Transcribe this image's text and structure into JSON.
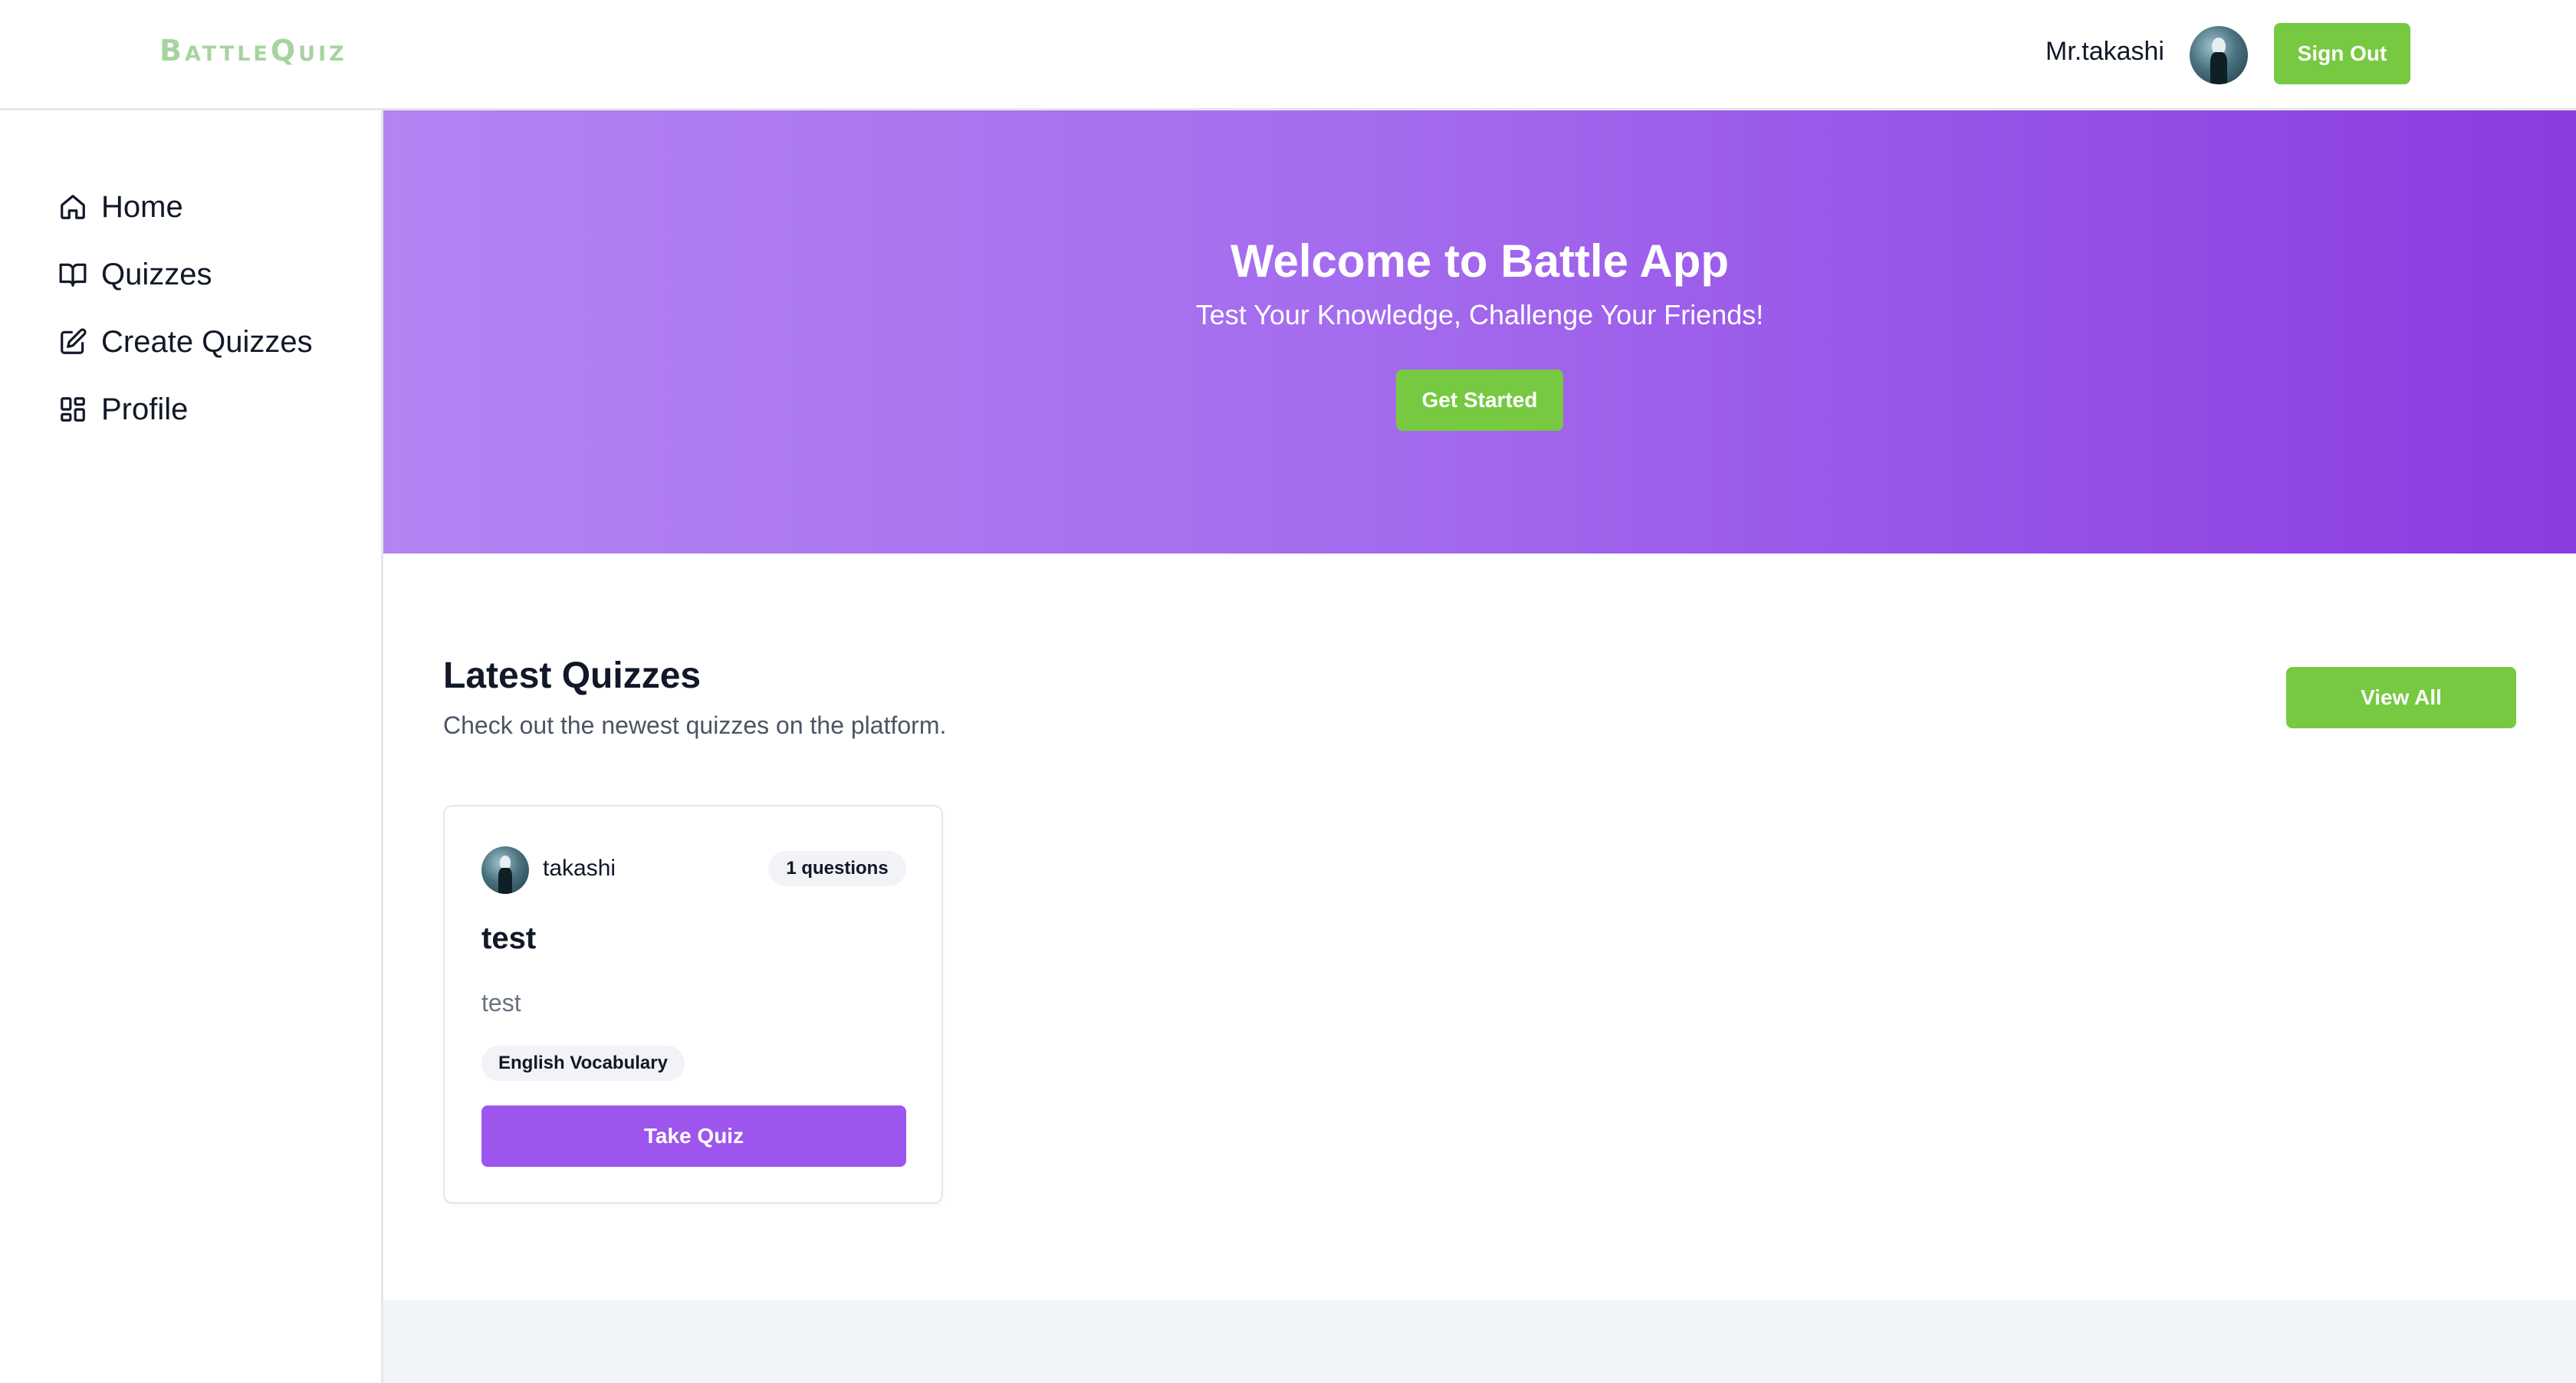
{
  "header": {
    "logo": "BattleQuiz",
    "user_name": "Mr.takashi",
    "sign_out_label": "Sign Out"
  },
  "sidebar": {
    "items": [
      {
        "label": "Home",
        "icon": "home-icon"
      },
      {
        "label": "Quizzes",
        "icon": "book-open-icon"
      },
      {
        "label": "Create Quizzes",
        "icon": "edit-icon"
      },
      {
        "label": "Profile",
        "icon": "grid-icon"
      }
    ]
  },
  "hero": {
    "title": "Welcome to Battle App",
    "subtitle": "Test Your Knowledge, Challenge Your Friends!",
    "cta_label": "Get Started"
  },
  "latest": {
    "title": "Latest Quizzes",
    "subtitle": "Check out the newest quizzes on the platform.",
    "view_all_label": "View All",
    "quizzes": [
      {
        "author": "takashi",
        "question_count": "1 questions",
        "title": "test",
        "description": "test",
        "category": "English Vocabulary",
        "action_label": "Take Quiz"
      }
    ]
  },
  "colors": {
    "accent_green": "#76c941",
    "accent_purple": "#9d55ee",
    "hero_gradient_start": "#b384f2",
    "hero_gradient_end": "#8b3ce0",
    "logo_color": "#a7d3a0"
  }
}
